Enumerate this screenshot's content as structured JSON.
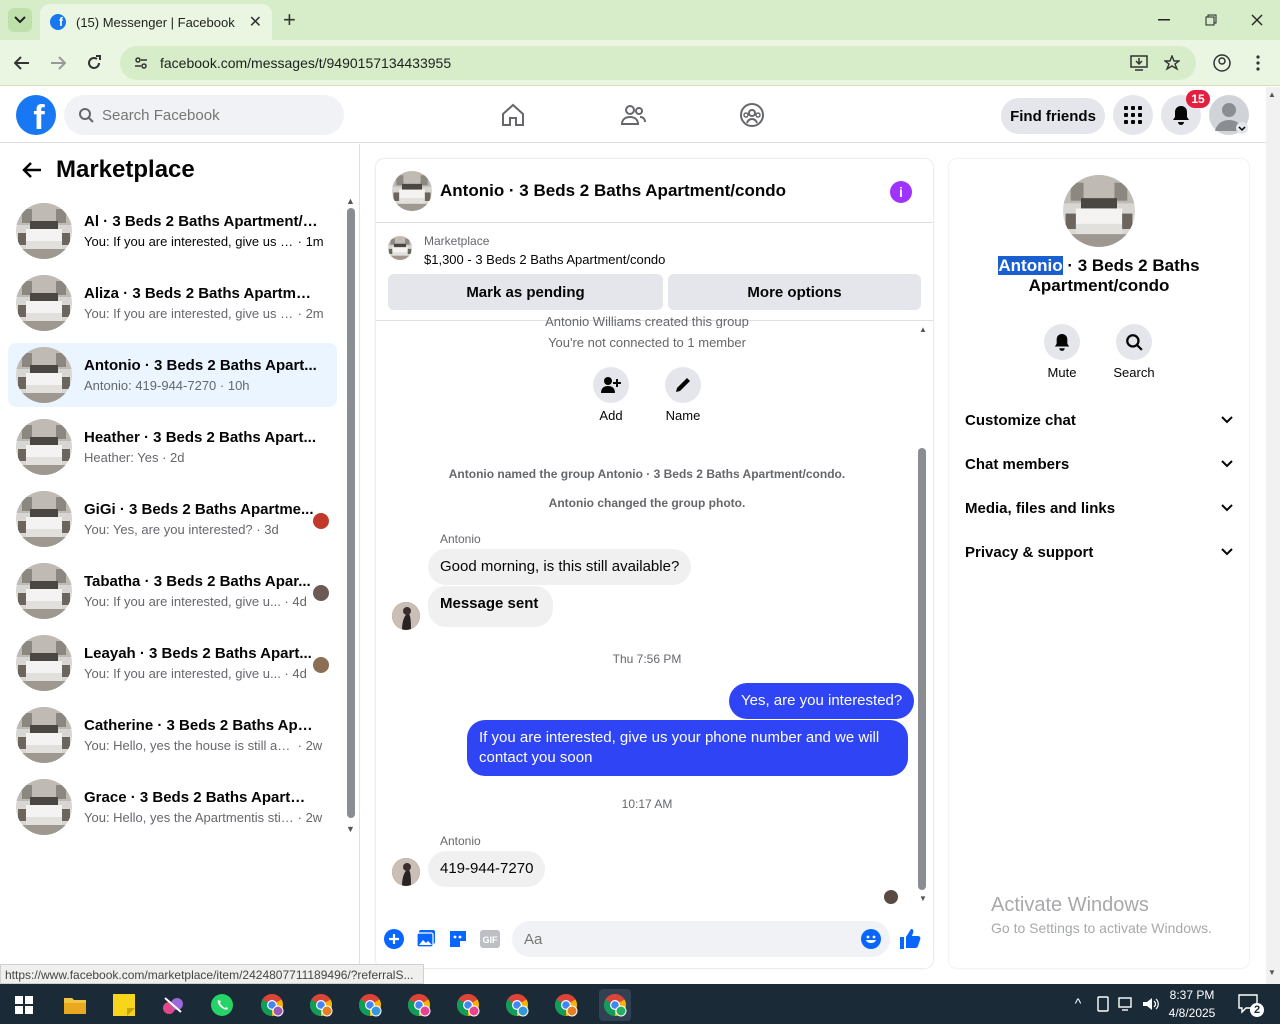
{
  "browser": {
    "tab_title": "(15) Messenger | Facebook",
    "url": "facebook.com/messages/t/9490157134433955",
    "status_url": "https://www.facebook.com/marketplace/item/2424807711189496/?referralS..."
  },
  "fb": {
    "search_placeholder": "Search Facebook",
    "find_friends": "Find friends",
    "notif_count": "15"
  },
  "sidebar": {
    "title": "Marketplace",
    "conversations": [
      {
        "name": "Al · 3 Beds 2 Baths Apartment/c...",
        "preview": "You: If you are interested, give us y...",
        "time": "1m",
        "unread": true
      },
      {
        "name": "Aliza · 3 Beds 2 Baths Apartmen...",
        "preview": "You: If you are interested, give us y...",
        "time": "2m",
        "unread": false
      },
      {
        "name": "Antonio · 3 Beds 2 Baths Apart...",
        "preview": "Antonio: 419-944-7270",
        "time": "10h",
        "unread": false
      },
      {
        "name": "Heather · 3 Beds 2 Baths Apart...",
        "preview": "Heather: Yes",
        "time": "2d",
        "unread": false
      },
      {
        "name": "GiGi · 3 Beds 2 Baths Apartme...",
        "preview": "You: Yes, are you interested?",
        "time": "3d",
        "unread": false
      },
      {
        "name": "Tabatha · 3 Beds 2 Baths Apar...",
        "preview": "You: If you are interested, give u...",
        "time": "4d",
        "unread": false
      },
      {
        "name": "Leayah · 3 Beds 2 Baths Apart...",
        "preview": "You: If you are interested, give u...",
        "time": "4d",
        "unread": false
      },
      {
        "name": "Catherine · 3 Beds 2 Baths Apart...",
        "preview": "You: Hello, yes the house is still ava...",
        "time": "2w",
        "unread": false
      },
      {
        "name": "Grace · 3 Beds 2 Baths Apartme...",
        "preview": "You: Hello, yes the Apartmentis still...",
        "time": "2w",
        "unread": false
      }
    ]
  },
  "chat": {
    "title": "Antonio · 3 Beds 2 Baths Apartment/condo",
    "marketplace_label": "Marketplace",
    "listing": "$1,300 - 3 Beds 2 Baths Apartment/condo",
    "mark_pending": "Mark as pending",
    "more_options": "More options",
    "created_text": "Antonio Williams created this group",
    "not_connected": "You're not connected to 1 member",
    "add_label": "Add",
    "name_label": "Name",
    "named_event": "Antonio named the group Antonio · 3 Beds 2 Baths Apartment/condo.",
    "photo_event": "Antonio changed the group photo.",
    "sender1": "Antonio",
    "msg1": "Good morning, is this still available?",
    "msg2": "Message sent",
    "time1": "Thu 7:56 PM",
    "out1": "Yes, are you interested?",
    "out2": "If you are interested, give us your phone number and we will contact you soon",
    "time2": "10:17 AM",
    "sender2": "Antonio",
    "msg3": "419-944-7270",
    "input_placeholder": "Aa"
  },
  "details": {
    "title_highlight": "Antonio",
    "title_rest": " · 3 Beds 2 Baths Apartment/condo",
    "mute": "Mute",
    "search": "Search",
    "sections": [
      "Customize chat",
      "Chat members",
      "Media, files and links",
      "Privacy & support"
    ]
  },
  "watermark": {
    "line1": "Activate Windows",
    "line2": "Go to Settings to activate Windows."
  },
  "taskbar": {
    "time": "8:37 PM",
    "date": "4/8/2025",
    "notif": "2"
  },
  "colors": {
    "brand": "#1877f2",
    "outgoing_bubble": "#2e44f5",
    "chrome": "#d7edc9"
  }
}
